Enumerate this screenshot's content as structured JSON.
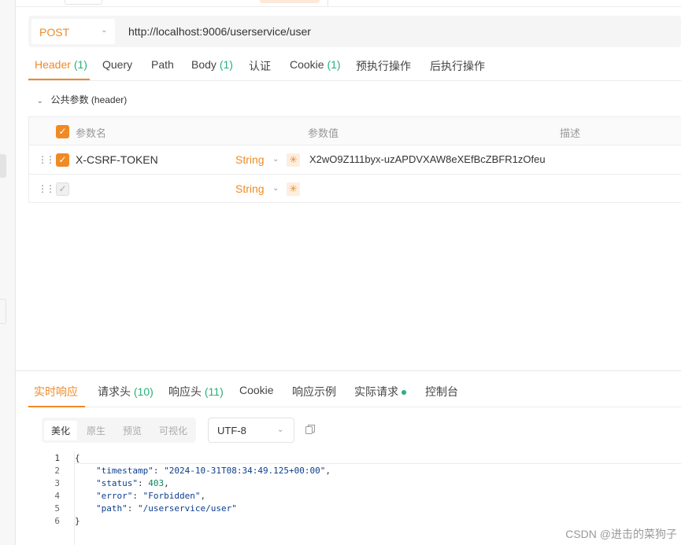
{
  "request": {
    "method": "POST",
    "url": "http://localhost:9006/userservice/user"
  },
  "req_tabs": [
    {
      "label": "Header",
      "count": "(1)"
    },
    {
      "label": "Query",
      "count": ""
    },
    {
      "label": "Path",
      "count": ""
    },
    {
      "label": "Body",
      "count": "(1)"
    },
    {
      "label": "认证",
      "count": ""
    },
    {
      "label": "Cookie",
      "count": "(1)"
    },
    {
      "label": "预执行操作",
      "count": ""
    },
    {
      "label": "后执行操作",
      "count": ""
    }
  ],
  "public_params": {
    "label": "公共参数",
    "sub": "(header)"
  },
  "table": {
    "headers": {
      "name": "参数名",
      "value": "参数值",
      "desc": "描述"
    },
    "rows": [
      {
        "name": "X-CSRF-TOKEN",
        "type": "String",
        "value": "X2wO9Z111byx-uzAPDVXAW8eXEfBcZBFR1zOfeu"
      },
      {
        "name": "",
        "type": "String",
        "value": ""
      }
    ]
  },
  "resp_tabs": [
    {
      "label": "实时响应",
      "count": ""
    },
    {
      "label": "请求头",
      "count": "(10)"
    },
    {
      "label": "响应头",
      "count": "(11)"
    },
    {
      "label": "Cookie",
      "count": ""
    },
    {
      "label": "响应示例",
      "count": ""
    },
    {
      "label": "实际请求",
      "count": ""
    },
    {
      "label": "控制台",
      "count": ""
    }
  ],
  "view_modes": [
    "美化",
    "原生",
    "预览",
    "可视化"
  ],
  "encoding": "UTF-8",
  "response_code": {
    "line_numbers": [
      "1",
      "2",
      "3",
      "4",
      "5",
      "6"
    ],
    "open_brace": "{",
    "close_brace": "}",
    "fields": [
      {
        "key": "\"timestamp\"",
        "value": "\"2024-10-31T08:34:49.125+00:00\"",
        "sep": ","
      },
      {
        "key": "\"status\"",
        "value": "403",
        "sep": ","
      },
      {
        "key": "\"error\"",
        "value": "\"Forbidden\"",
        "sep": ","
      },
      {
        "key": "\"path\"",
        "value": "\"/userservice/user\"",
        "sep": ""
      }
    ]
  },
  "watermark": "CSDN @进击的菜狗子",
  "colors": {
    "accent": "#f08a24",
    "count": "#27b07a"
  },
  "icons": [
    "chevron-down-icon",
    "drag-handle-icon",
    "checkbox-icon",
    "required-star-icon",
    "copy-icon"
  ]
}
